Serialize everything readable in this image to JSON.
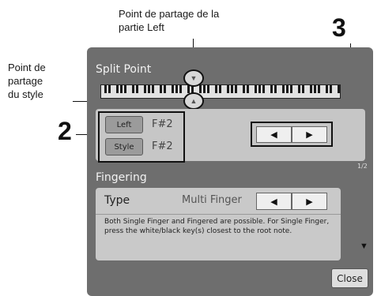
{
  "annotations": {
    "top_label": "Point de partage de la partie Left",
    "top_label_line1": "Point de partage de la",
    "top_label_line2": "partie Left",
    "left_label_line1": "Point de",
    "left_label_line2": "partage",
    "left_label_line3": "du style",
    "callout_2": "2",
    "callout_3": "3"
  },
  "split_point": {
    "title": "Split Point",
    "left_button": "Left",
    "left_value": "F#2",
    "style_button": "Style",
    "style_value": "F#2",
    "arrow_left_icon": "◀",
    "arrow_right_icon": "▶",
    "page_indicator": "1/2"
  },
  "fingering": {
    "title": "Fingering",
    "type_label": "Type",
    "type_value": "Multi Finger",
    "arrow_left_icon": "◀",
    "arrow_right_icon": "▶",
    "description": "Both Single Finger and Fingered are possible. For Single Finger, press the white/black key(s) closest to the root note.",
    "scroll_down_icon": "▼"
  },
  "close_button": "Close",
  "colors": {
    "panel_bg": "#6e6e6e",
    "inner_bg": "#c6c6c6",
    "button_bg": "#9b9b9b"
  }
}
